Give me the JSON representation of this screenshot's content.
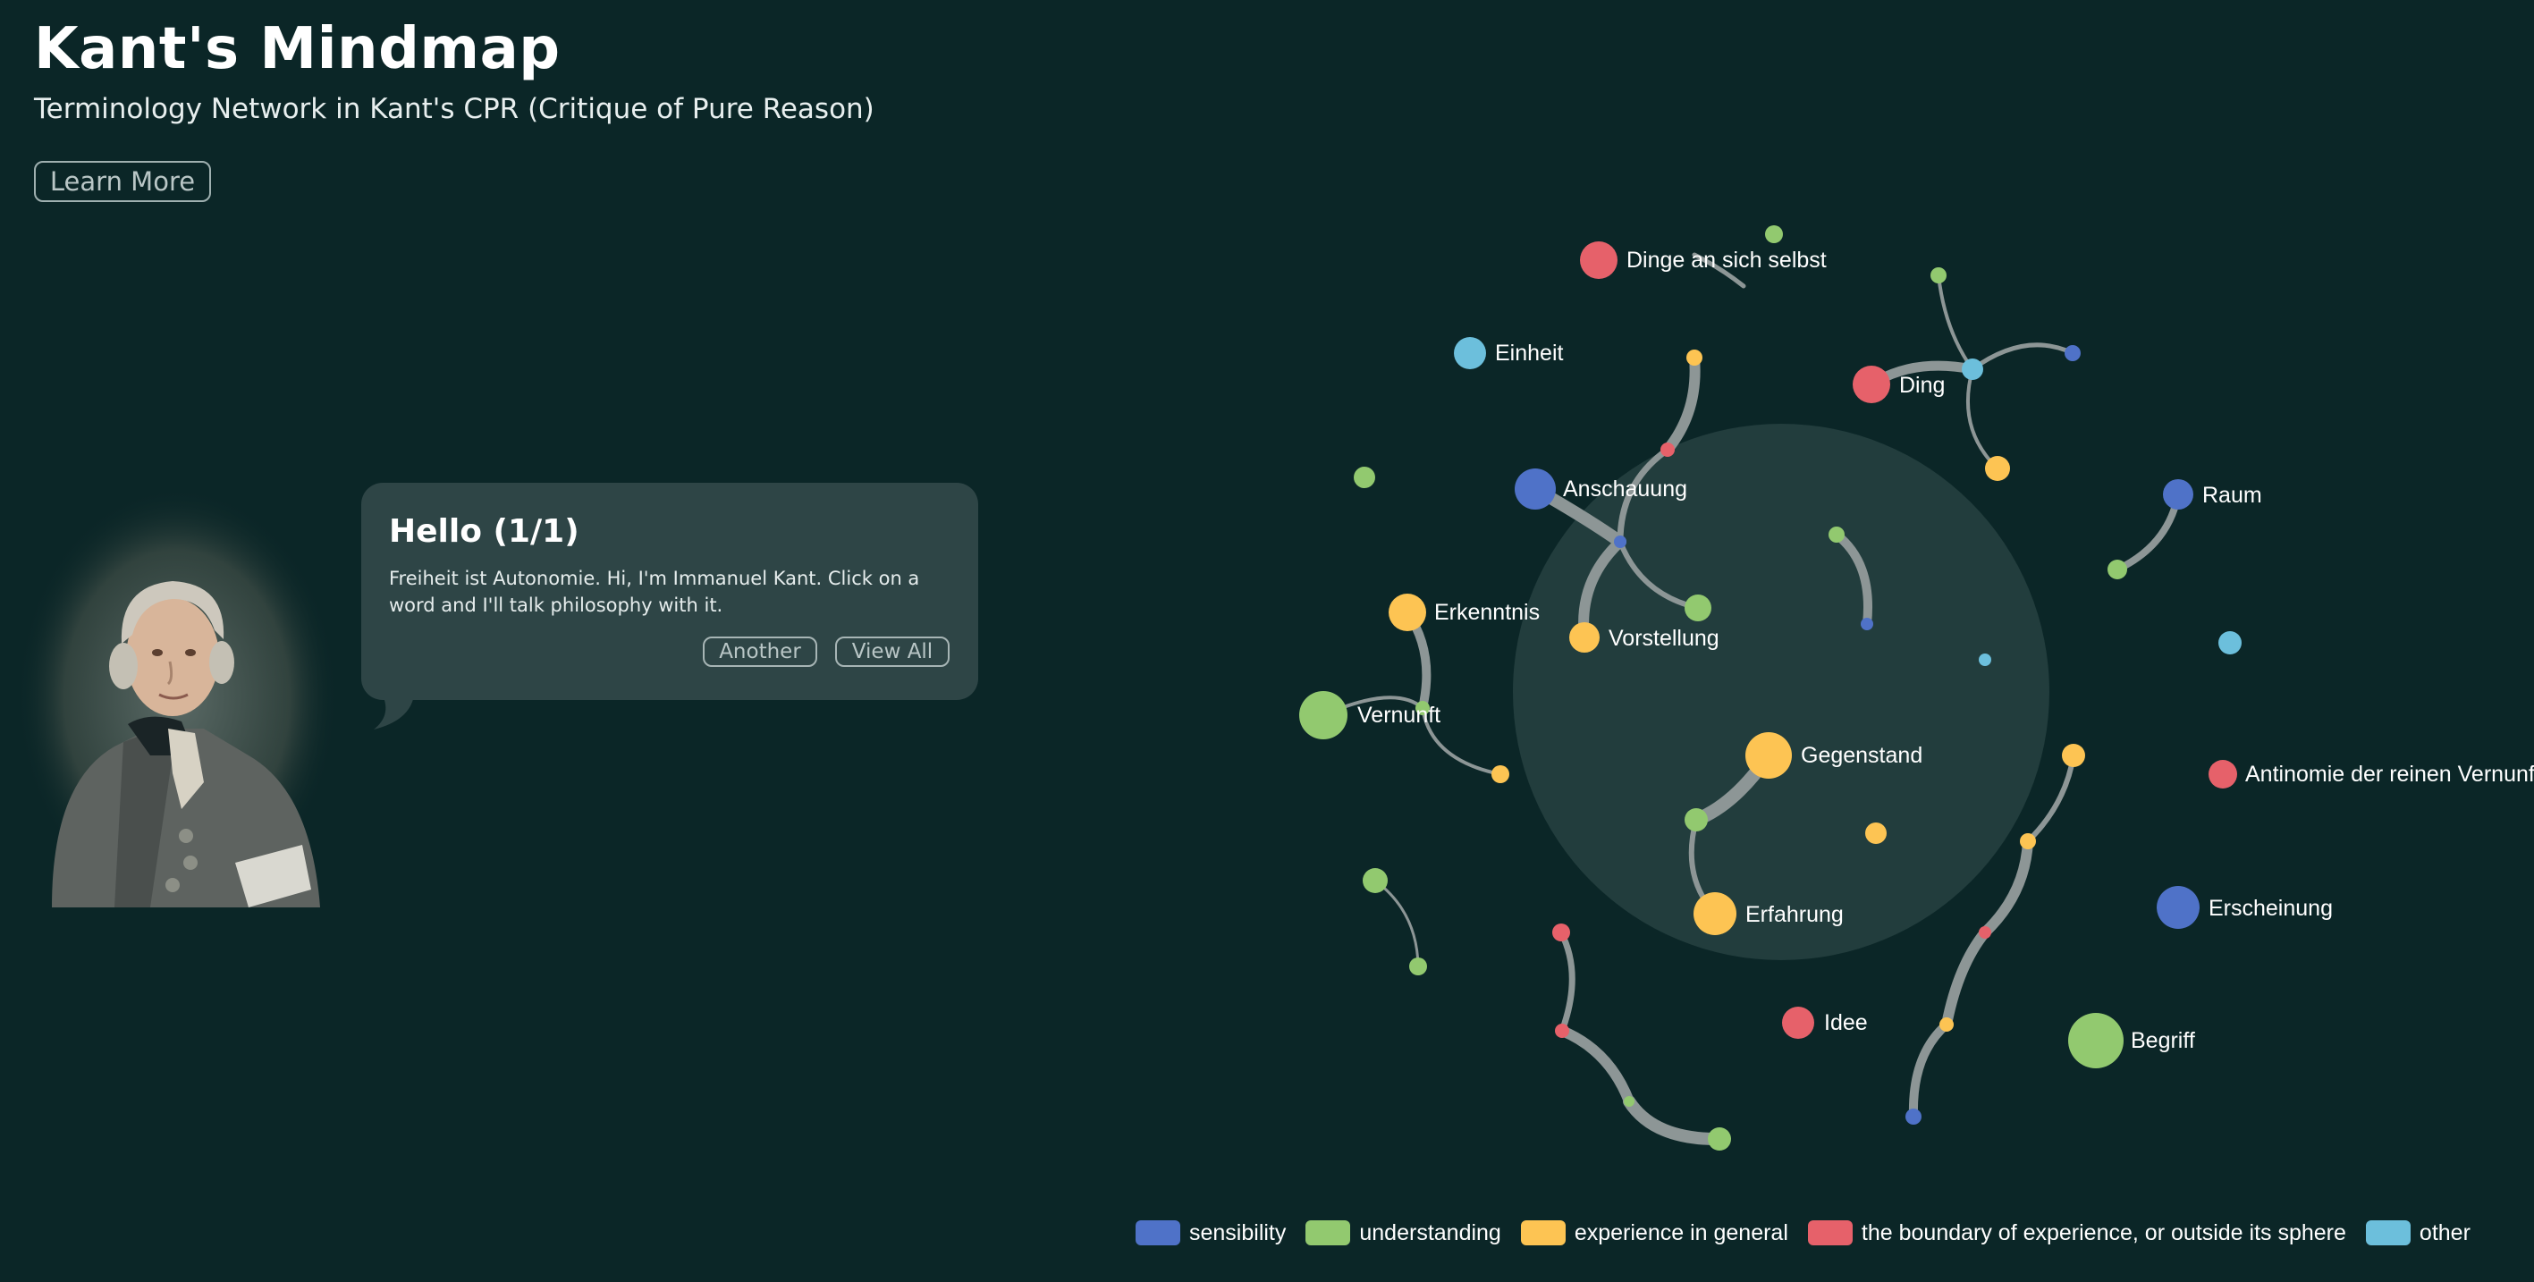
{
  "header": {
    "title": "Kant's Mindmap",
    "subtitle": "Terminology Network in Kant's CPR (Critique of Pure Reason)",
    "learn_more_label": "Learn More"
  },
  "speech": {
    "heading": "Hello (1/1)",
    "text": "Freiheit ist Autonomie. Hi, I'm Immanuel Kant. Click on a word and I'll talk philosophy with it.",
    "another_label": "Another",
    "view_all_label": "View All"
  },
  "colors": {
    "background": "#0b2627",
    "sensibility": "#4f72c8",
    "understanding": "#92c96f",
    "experience": "#fdc453",
    "boundary": "#e6616a",
    "other": "#6cbfdc",
    "link": "#8d9696"
  },
  "legend": [
    {
      "label": "sensibility",
      "color": "#4f72c8"
    },
    {
      "label": "understanding",
      "color": "#92c96f"
    },
    {
      "label": "experience in general",
      "color": "#fdc453"
    },
    {
      "label": "the boundary of experience, or outside its sphere",
      "color": "#e6616a"
    },
    {
      "label": "other",
      "color": "#6cbfdc"
    }
  ],
  "terms": {
    "dinge": "Dinge an sich selbst",
    "einheit": "Einheit",
    "ding": "Ding",
    "anschauung": "Anschauung",
    "raum": "Raum",
    "erkenntnis": "Erkenntnis",
    "vorstellung": "Vorstellung",
    "vernunft": "Vernunft",
    "gegenstand": "Gegenstand",
    "antinomie": "Antinomie der reinen Vernunft",
    "erscheinung": "Erscheinung",
    "erfahrung": "Erfahrung",
    "idee": "Idee",
    "begriff": "Begriff"
  },
  "icons": {
    "portrait": "kant-portrait",
    "bubble_tail": "speech-bubble-tail"
  }
}
